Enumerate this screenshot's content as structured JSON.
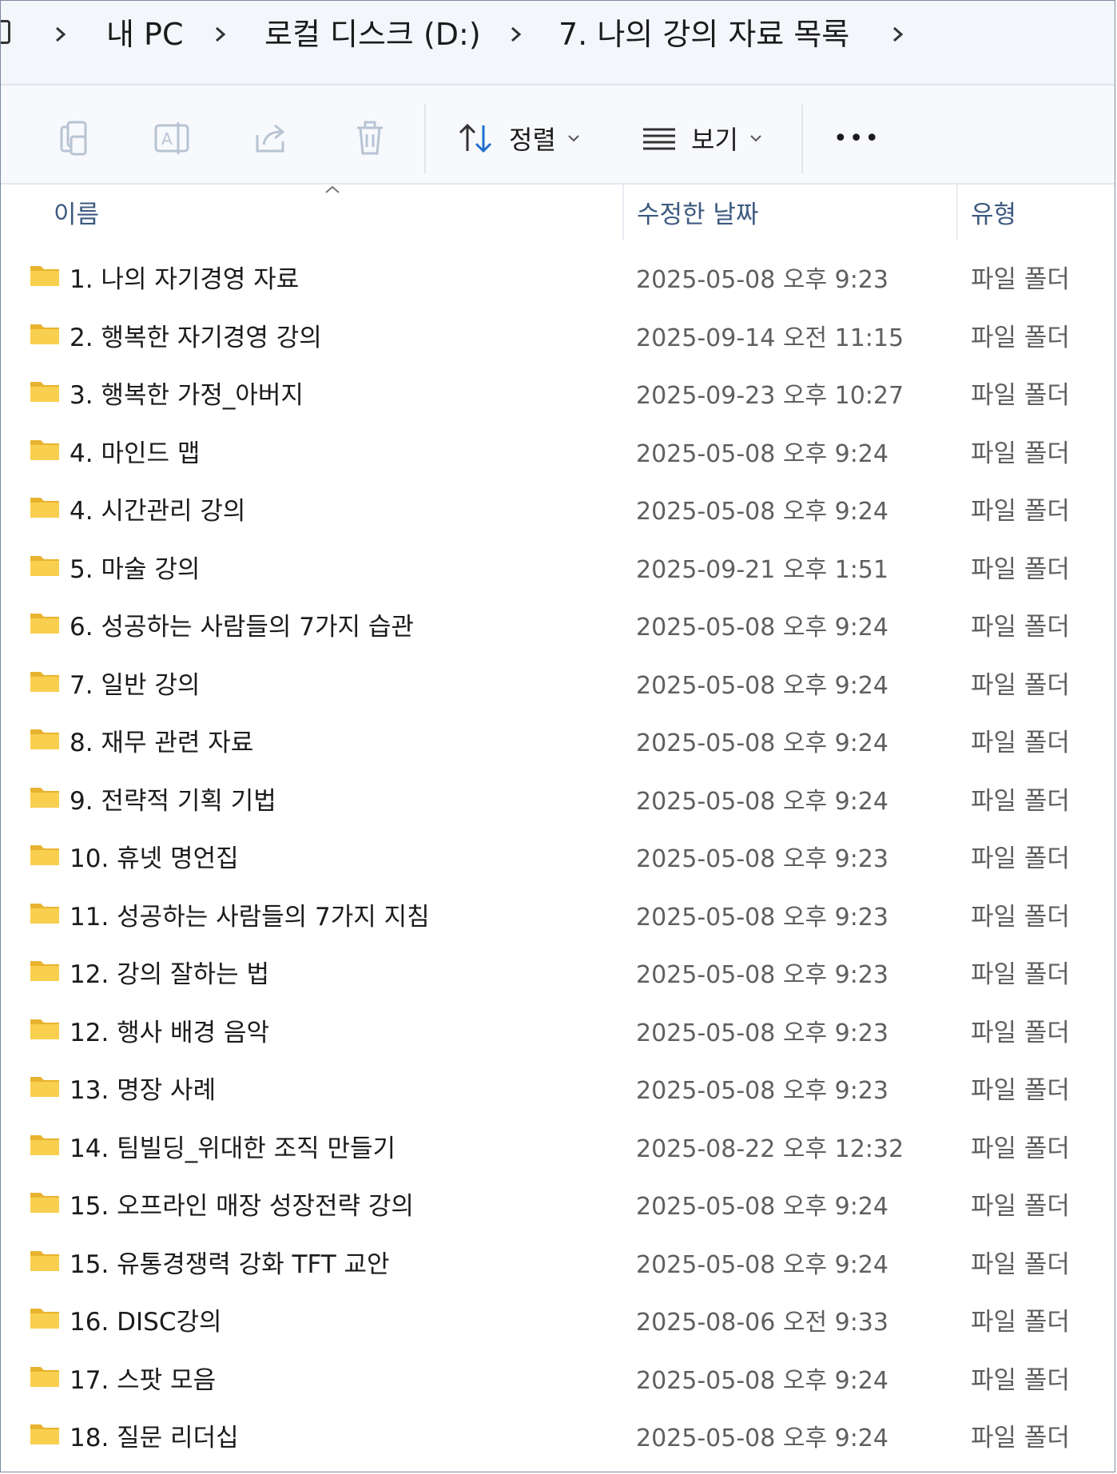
{
  "breadcrumb": {
    "items": [
      "내 PC",
      "로컬 디스크 (D:)",
      "7. 나의 강의 자료 목록"
    ]
  },
  "toolbar": {
    "copy_icon": "copy-icon",
    "rename_icon": "rename-icon",
    "share_icon": "share-icon",
    "delete_icon": "trash-icon",
    "sort_label": "정렬",
    "view_label": "보기",
    "more_label": "•••"
  },
  "columns": {
    "name": "이름",
    "modified": "수정한 날짜",
    "type": "유형"
  },
  "colors": {
    "accent": "#1f6fd1",
    "folder": "#f5c542",
    "header_text": "#3d5a80"
  },
  "files": [
    {
      "name": "1. 나의 자기경영 자료",
      "modified": "2025-05-08 오후 9:23",
      "type": "파일 폴더"
    },
    {
      "name": "2. 행복한 자기경영 강의",
      "modified": "2025-09-14 오전 11:15",
      "type": "파일 폴더"
    },
    {
      "name": "3. 행복한 가정_아버지",
      "modified": "2025-09-23 오후 10:27",
      "type": "파일 폴더"
    },
    {
      "name": "4. 마인드 맵",
      "modified": "2025-05-08 오후 9:24",
      "type": "파일 폴더"
    },
    {
      "name": "4. 시간관리 강의",
      "modified": "2025-05-08 오후 9:24",
      "type": "파일 폴더"
    },
    {
      "name": "5. 마술 강의",
      "modified": "2025-09-21 오후 1:51",
      "type": "파일 폴더"
    },
    {
      "name": "6. 성공하는 사람들의 7가지 습관",
      "modified": "2025-05-08 오후 9:24",
      "type": "파일 폴더"
    },
    {
      "name": "7. 일반 강의",
      "modified": "2025-05-08 오후 9:24",
      "type": "파일 폴더"
    },
    {
      "name": "8. 재무 관련 자료",
      "modified": "2025-05-08 오후 9:24",
      "type": "파일 폴더"
    },
    {
      "name": "9. 전략적 기획 기법",
      "modified": "2025-05-08 오후 9:24",
      "type": "파일 폴더"
    },
    {
      "name": "10. 휴넷 명언집",
      "modified": "2025-05-08 오후 9:23",
      "type": "파일 폴더"
    },
    {
      "name": "11. 성공하는 사람들의 7가지 지침",
      "modified": "2025-05-08 오후 9:23",
      "type": "파일 폴더"
    },
    {
      "name": "12. 강의 잘하는 법",
      "modified": "2025-05-08 오후 9:23",
      "type": "파일 폴더"
    },
    {
      "name": "12. 행사 배경 음악",
      "modified": "2025-05-08 오후 9:23",
      "type": "파일 폴더"
    },
    {
      "name": "13. 명장 사례",
      "modified": "2025-05-08 오후 9:23",
      "type": "파일 폴더"
    },
    {
      "name": "14. 팀빌딩_위대한 조직 만들기",
      "modified": "2025-08-22 오후 12:32",
      "type": "파일 폴더"
    },
    {
      "name": "15. 오프라인 매장 성장전략 강의",
      "modified": "2025-05-08 오후 9:24",
      "type": "파일 폴더"
    },
    {
      "name": "15. 유통경쟁력 강화 TFT 교안",
      "modified": "2025-05-08 오후 9:24",
      "type": "파일 폴더"
    },
    {
      "name": "16. DISC강의",
      "modified": "2025-08-06 오전 9:33",
      "type": "파일 폴더"
    },
    {
      "name": "17. 스팟 모음",
      "modified": "2025-05-08 오후 9:24",
      "type": "파일 폴더"
    },
    {
      "name": "18. 질문 리더십",
      "modified": "2025-05-08 오후 9:24",
      "type": "파일 폴더"
    }
  ]
}
